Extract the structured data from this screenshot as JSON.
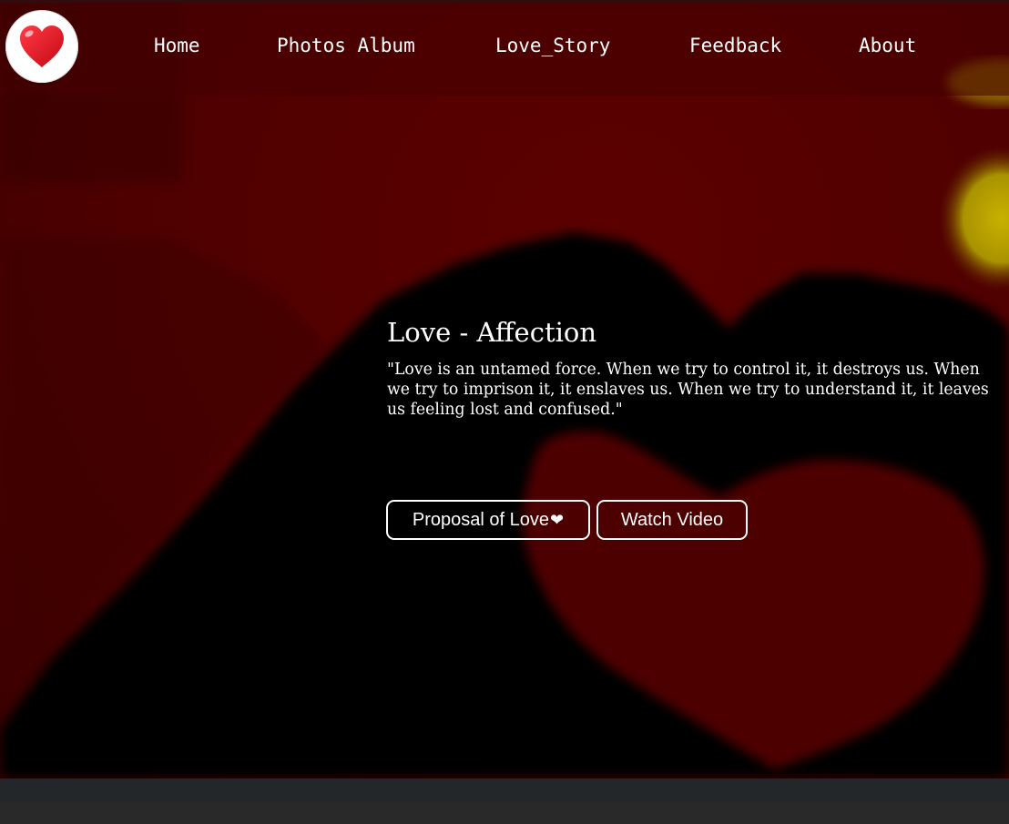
{
  "navbar": {
    "logo_icon": "heart-icon",
    "links": [
      {
        "label": "Home"
      },
      {
        "label": "Photos Album"
      },
      {
        "label": "Love_Story"
      },
      {
        "label": "Feedback"
      },
      {
        "label": "About"
      }
    ]
  },
  "hero": {
    "title": "Love - Affection",
    "quote": "\"Love is an untamed force. When we try to control it, it destroys us. When we try to imprison it, it enslaves us. When we try to understand it, it leaves us feeling lost and confused.\"",
    "buttons": {
      "proposal_label": "Proposal of Love",
      "proposal_icon": "heart-icon",
      "video_label": "Watch Video"
    }
  },
  "colors": {
    "background_red": "#4e0000",
    "logo_heart": "#e4111e",
    "text": "#ffffff",
    "footer": "#23272a"
  }
}
